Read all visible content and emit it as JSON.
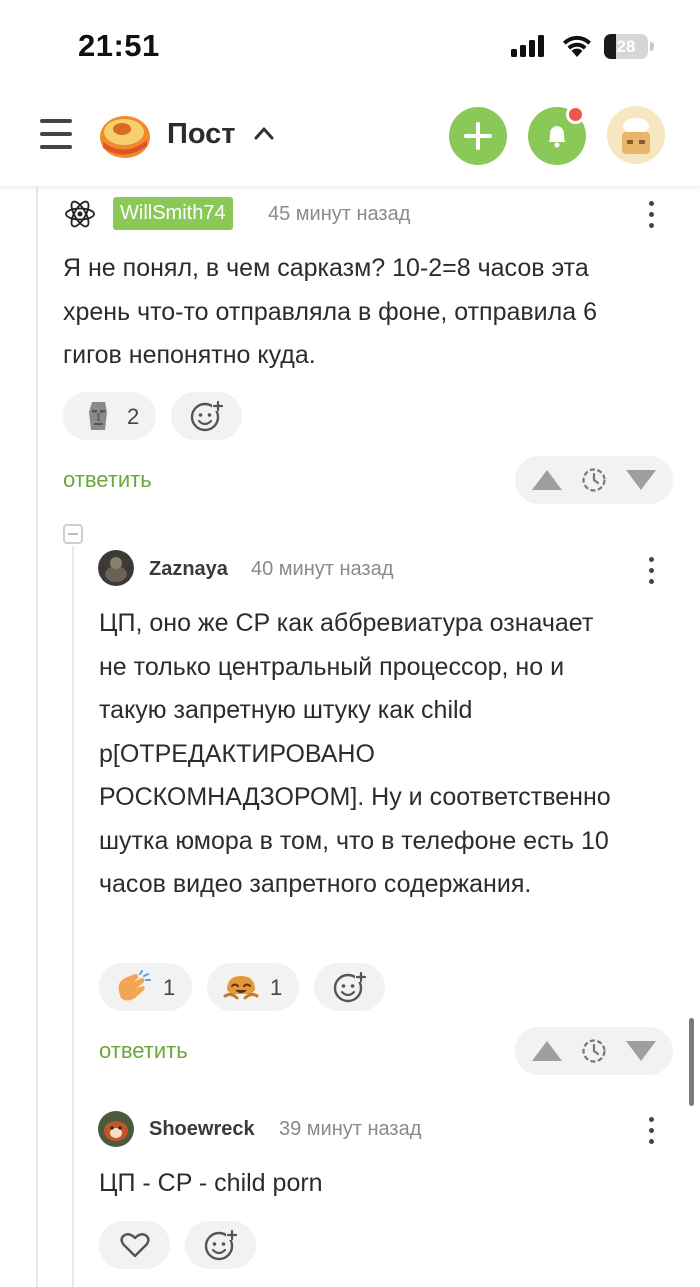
{
  "status_bar": {
    "time": "21:51",
    "battery_level": "28",
    "battery_fraction": 0.28
  },
  "header": {
    "title": "Пост",
    "icons": [
      "menu-icon",
      "pikabu-logo",
      "chevron-up-icon",
      "plus-icon",
      "bell-icon",
      "user-avatar"
    ],
    "accent_color": "#8ac858",
    "notification_dot_color": "#f0554a"
  },
  "comments": [
    {
      "author": "WillSmith74",
      "time": "45 минут назад",
      "text": "Я не понял, в чем сарказм? 10-2=8 часов эта хрень что-то отправляла в фоне, отправила 6 гигов непонятно куда.",
      "reactions": [
        {
          "icon": "moai-icon",
          "count": "2"
        }
      ],
      "reply_label": "ответить"
    },
    {
      "author": "Zaznaya",
      "time": "40 минут назад",
      "text": "ЦП, оно же CP как аббревиатура означает не только центральный процессор, но и такую запретную штуку как child p[ОТРЕДАКТИРОВАНО РОСКОМНАДЗОРОМ]. Ну и соответственно шутка юмора в том, что в телефоне есть 10 часов видео запретного содержания.",
      "reactions": [
        {
          "icon": "clapping-hands-icon",
          "count": "1"
        },
        {
          "icon": "laughing-face-icon",
          "count": "1"
        }
      ],
      "reply_label": "ответить"
    },
    {
      "author": "Shoewreck",
      "time": "39 минут назад",
      "text": "ЦП - CP - child porn",
      "reactions": [
        {
          "icon": "heart-icon",
          "count": ""
        }
      ]
    }
  ]
}
